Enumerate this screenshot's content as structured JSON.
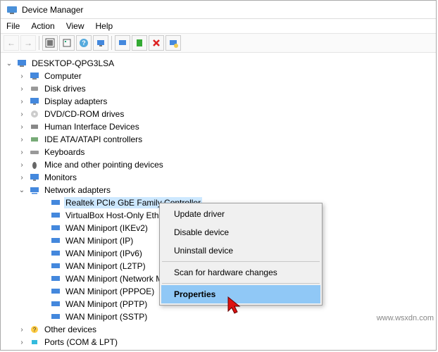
{
  "window": {
    "title": "Device Manager"
  },
  "menu": {
    "file": "File",
    "action": "Action",
    "view": "View",
    "help": "Help"
  },
  "root": {
    "label": "DESKTOP-QPG3LSA"
  },
  "categories": {
    "computer": "Computer",
    "disk": "Disk drives",
    "display": "Display adapters",
    "dvd": "DVD/CD-ROM drives",
    "hid": "Human Interface Devices",
    "ide": "IDE ATA/ATAPI controllers",
    "keyboards": "Keyboards",
    "mice": "Mice and other pointing devices",
    "monitors": "Monitors",
    "network": "Network adapters",
    "other": "Other devices",
    "ports": "Ports (COM & LPT)"
  },
  "network_devices": {
    "realtek": "Realtek PCIe GbE Family Controller",
    "vbox": "VirtualBox Host-Only Ethernet Adapter",
    "wan_ikev2": "WAN Miniport (IKEv2)",
    "wan_ip": "WAN Miniport (IP)",
    "wan_ipv6": "WAN Miniport (IPv6)",
    "wan_l2tp": "WAN Miniport (L2TP)",
    "wan_netmon": "WAN Miniport (Network Monitor)",
    "wan_pppoe": "WAN Miniport (PPPOE)",
    "wan_pptp": "WAN Miniport (PPTP)",
    "wan_sstp": "WAN Miniport (SSTP)"
  },
  "context_menu": {
    "update": "Update driver",
    "disable": "Disable device",
    "uninstall": "Uninstall device",
    "scan": "Scan for hardware changes",
    "properties": "Properties"
  },
  "icons": {
    "back": "←",
    "forward": "→",
    "collapsed": "›",
    "expanded": "⌄"
  },
  "watermark": "www.wsxdn.com"
}
